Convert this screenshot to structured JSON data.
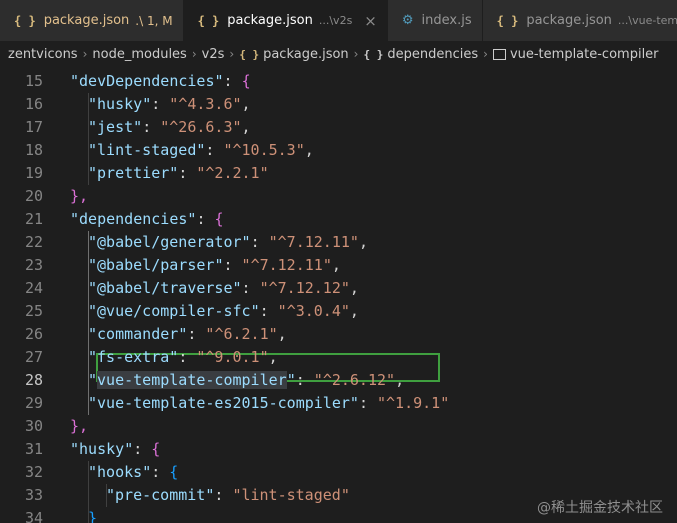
{
  "tabs": [
    {
      "icon": "{ }",
      "name": "package.json",
      "description": ".\\ 1, M",
      "modified": true,
      "active": false
    },
    {
      "icon": "{ }",
      "name": "package.json",
      "description": "...\\v2s",
      "modified": false,
      "active": true,
      "close": "×"
    },
    {
      "icon": "JS",
      "name": "index.js",
      "description": "",
      "modified": false,
      "active": false
    },
    {
      "icon": "{ }",
      "name": "package.json",
      "description": "...\\vue-template",
      "modified": false,
      "active": false
    }
  ],
  "breadcrumb": {
    "items": [
      "zentvicons",
      "node_modules",
      "v2s",
      "package.json",
      "dependencies",
      "vue-template-compiler"
    ],
    "icons": {
      "file": "{ }",
      "object": "{ }",
      "string": "str"
    }
  },
  "code_lines": [
    {
      "n": "15",
      "indent": 1,
      "key": "devDependencies",
      "after": ": ",
      "open": "{",
      "brace": "brace2"
    },
    {
      "n": "16",
      "indent": 2,
      "key": "husky",
      "value": "^4.3.6",
      "comma": ","
    },
    {
      "n": "17",
      "indent": 2,
      "key": "jest",
      "value": "^26.6.3",
      "comma": ","
    },
    {
      "n": "18",
      "indent": 2,
      "key": "lint-staged",
      "value": "^10.5.3",
      "comma": ","
    },
    {
      "n": "19",
      "indent": 2,
      "key": "prettier",
      "value": "^2.2.1",
      "comma": ""
    },
    {
      "n": "20",
      "indent": 1,
      "close": "},",
      "brace": "brace2"
    },
    {
      "n": "21",
      "indent": 1,
      "key": "dependencies",
      "after": ": ",
      "open": "{",
      "brace": "brace2"
    },
    {
      "n": "22",
      "indent": 2,
      "key": "@babel/generator",
      "value": "^7.12.11",
      "comma": ","
    },
    {
      "n": "23",
      "indent": 2,
      "key": "@babel/parser",
      "value": "^7.12.11",
      "comma": ","
    },
    {
      "n": "24",
      "indent": 2,
      "key": "@babel/traverse",
      "value": "^7.12.12",
      "comma": ","
    },
    {
      "n": "25",
      "indent": 2,
      "key": "@vue/compiler-sfc",
      "value": "^3.0.4",
      "comma": ","
    },
    {
      "n": "26",
      "indent": 2,
      "key": "commander",
      "value": "^6.2.1",
      "comma": ","
    },
    {
      "n": "27",
      "indent": 2,
      "key": "fs-extra",
      "value": "^9.0.1",
      "comma": ","
    },
    {
      "n": "28",
      "indent": 2,
      "key": "vue-template-compiler",
      "value": "^2.6.12",
      "comma": ",",
      "current": true
    },
    {
      "n": "29",
      "indent": 2,
      "key": "vue-template-es2015-compiler",
      "value": "^1.9.1",
      "comma": ""
    },
    {
      "n": "30",
      "indent": 1,
      "close": "},",
      "brace": "brace2"
    },
    {
      "n": "31",
      "indent": 1,
      "key": "husky",
      "after": ": ",
      "open": "{",
      "brace": "brace2"
    },
    {
      "n": "32",
      "indent": 2,
      "key": "hooks",
      "after": ": ",
      "open": "{",
      "brace": "brace3"
    },
    {
      "n": "33",
      "indent": 3,
      "key": "pre-commit",
      "value": "lint-staged",
      "comma": ""
    },
    {
      "n": "34",
      "indent": 2,
      "close": "}",
      "brace": "brace3"
    }
  ],
  "watermark": "@稀土掘金技术社区",
  "colors": {
    "key": "#9cdcfe",
    "string": "#ce9178",
    "highlight_box": "#3f9f3f"
  }
}
